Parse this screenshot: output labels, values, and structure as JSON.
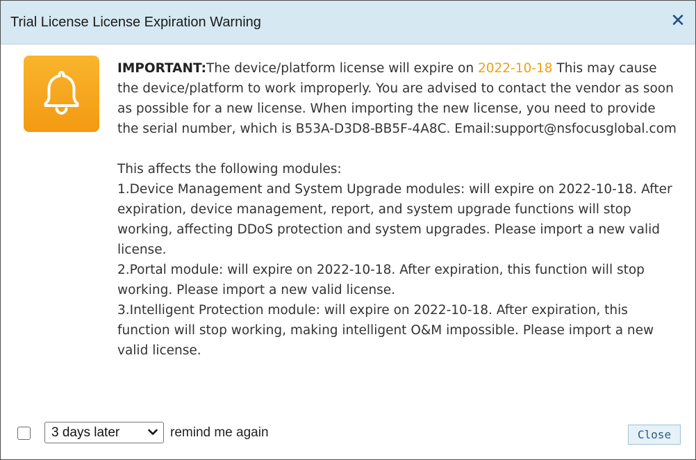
{
  "dialog": {
    "title": "Trial License License Expiration Warning",
    "close_icon": "close-icon",
    "close_glyph": "✕"
  },
  "icon": {
    "name": "bell-icon",
    "background_colors": [
      "#f9b52c",
      "#f39a12"
    ]
  },
  "message": {
    "important_label": "IMPORTANT:",
    "intro_before_date": "The device/platform license will expire on ",
    "expire_date": "2022-10-18",
    "intro_after_date": " This may cause the device/platform to work improperly. You are advised to contact the vendor as soon as possible for a new license. When importing the new license, you need to provide the serial number, which is B53A-D3D8-BB5F-4A8C. Email:support@nsfocusglobal.com",
    "modules_heading": "This affects the following modules:",
    "module_1": "1.Device Management and System Upgrade modules: will expire on 2022-10-18. After expiration, device management, report, and system upgrade functions will stop working, affecting DDoS protection and system upgrades. Please import a new valid license.",
    "module_2": "2.Portal module: will expire on 2022-10-18. After expiration, this function will stop working. Please import a new valid license.",
    "module_3": "3.Intelligent Protection module: will expire on 2022-10-18. After expiration, this function will stop working, making intelligent O&M impossible. Please import a new valid license."
  },
  "footer": {
    "checkbox_checked": false,
    "remind_select_value": "3 days later",
    "remind_label": "remind me again",
    "close_button_label": "Close"
  },
  "colors": {
    "titlebar": "#d6e8f1",
    "accent_date": "#f2a013",
    "close_icon": "#1d4f86"
  }
}
